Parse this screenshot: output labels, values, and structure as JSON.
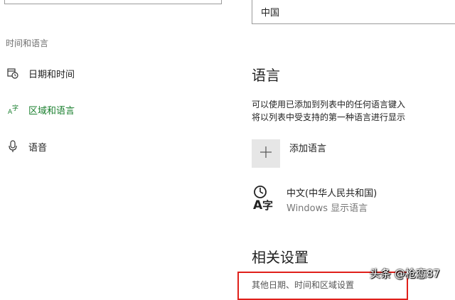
{
  "sidebar": {
    "section_title": "时间和语言",
    "items": [
      {
        "label": "日期和时间",
        "icon": "calendar-clock-icon",
        "active": false
      },
      {
        "label": "区域和语言",
        "icon": "region-language-icon",
        "active": true
      },
      {
        "label": "语音",
        "icon": "microphone-icon",
        "active": false
      }
    ]
  },
  "main": {
    "country_value": "中国",
    "language_heading": "语言",
    "description_lines": [
      "可以使用已添加到列表中的任何语言键入",
      "将以列表中受支持的第一种语言进行显示"
    ],
    "add_language_label": "添加语言",
    "languages": [
      {
        "name": "中文(中华人民共和国)",
        "subtitle": "Windows 显示语言",
        "icon": "language-font-icon"
      }
    ],
    "related_heading": "相关设置",
    "related_link": "其他日期、时间和区域设置"
  },
  "watermark": "头条 @枪恋87",
  "colors": {
    "accent_active": "#1a7f2e",
    "highlight_border": "#e0201a",
    "add_button_bg": "#e6e6e6"
  }
}
